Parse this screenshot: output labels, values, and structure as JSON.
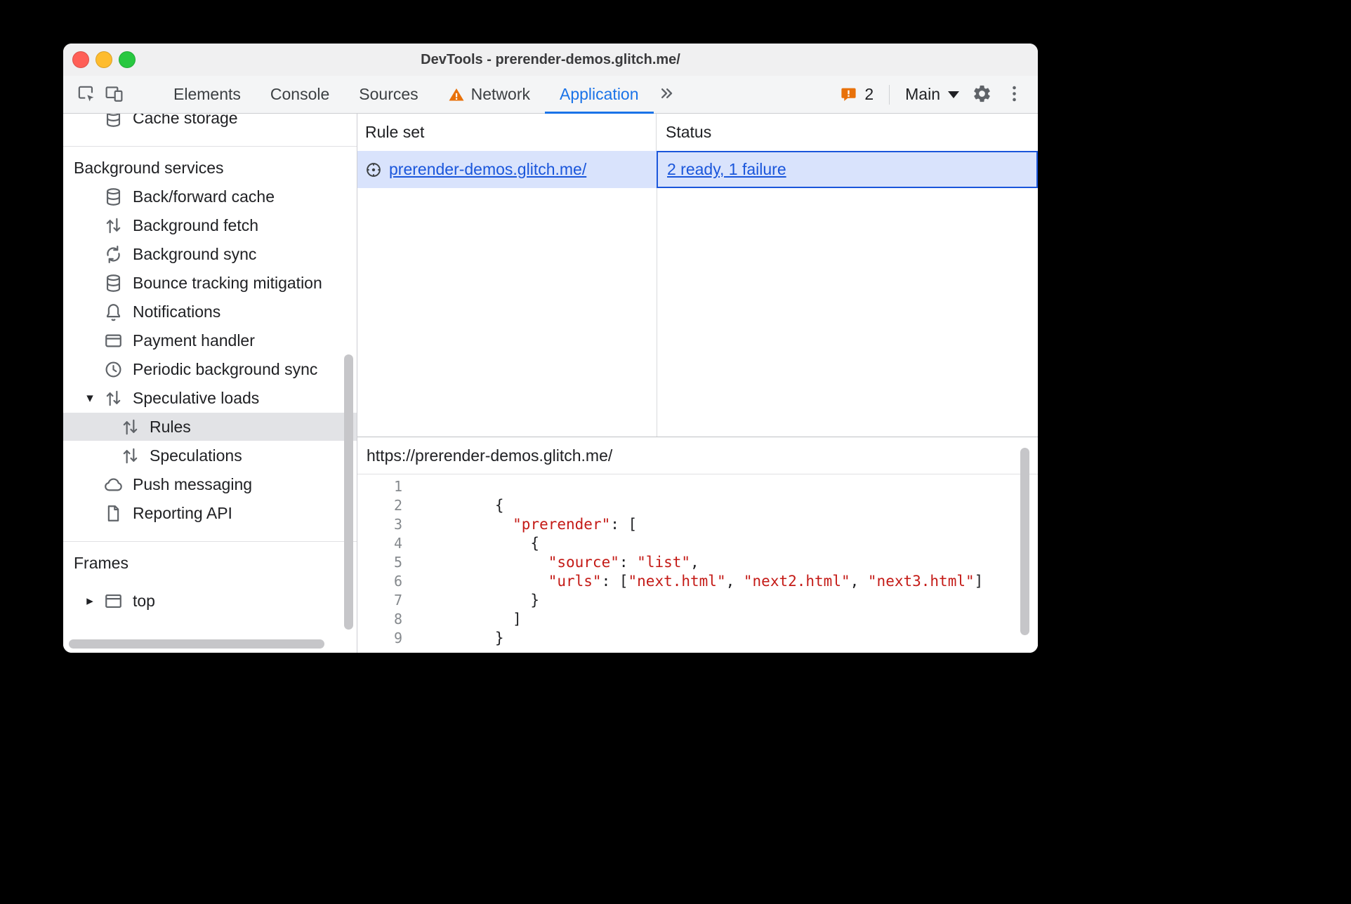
{
  "window": {
    "title": "DevTools - prerender-demos.glitch.me/"
  },
  "toolbar": {
    "tabs": [
      {
        "label": "Elements"
      },
      {
        "label": "Console"
      },
      {
        "label": "Sources"
      },
      {
        "label": "Network",
        "warning": true
      },
      {
        "label": "Application",
        "selected": true
      }
    ],
    "issues": {
      "count": "2"
    },
    "target_selector": {
      "label": "Main"
    }
  },
  "sidebar": {
    "clipped_item": {
      "label": "Cache storage",
      "icon": "database-icon"
    },
    "sections": [
      {
        "title": "Background services",
        "items": [
          {
            "label": "Back/forward cache",
            "icon": "database-icon"
          },
          {
            "label": "Background fetch",
            "icon": "up-down-arrows-icon"
          },
          {
            "label": "Background sync",
            "icon": "sync-arrows-icon"
          },
          {
            "label": "Bounce tracking mitigation",
            "icon": "database-icon"
          },
          {
            "label": "Notifications",
            "icon": "bell-icon"
          },
          {
            "label": "Payment handler",
            "icon": "payment-card-icon"
          },
          {
            "label": "Periodic background sync",
            "icon": "clock-icon"
          },
          {
            "label": "Speculative loads",
            "icon": "up-down-arrows-icon",
            "disclosure": "expanded"
          },
          {
            "label": "Rules",
            "icon": "up-down-arrows-icon",
            "indent": 1,
            "selected": true
          },
          {
            "label": "Speculations",
            "icon": "up-down-arrows-icon",
            "indent": 1
          },
          {
            "label": "Push messaging",
            "icon": "cloud-icon"
          },
          {
            "label": "Reporting API",
            "icon": "file-icon"
          }
        ]
      },
      {
        "title": "Frames",
        "items": [
          {
            "label": "top",
            "icon": "frame-icon",
            "disclosure": "collapsed"
          }
        ]
      }
    ]
  },
  "rule_sets": {
    "columns": [
      "Rule set",
      "Status"
    ],
    "rows": [
      {
        "rule_set": "prerender-demos.glitch.me/",
        "status": "2 ready, 1 failure",
        "icon": "rule-set-icon",
        "selected": true
      }
    ]
  },
  "details": {
    "url": "https://prerender-demos.glitch.me/",
    "code": {
      "lines": [
        {
          "n": "1",
          "tokens": []
        },
        {
          "n": "2",
          "tokens": [
            {
              "t": "      {",
              "c": "pun"
            }
          ]
        },
        {
          "n": "3",
          "tokens": [
            {
              "t": "        ",
              "c": "pun"
            },
            {
              "t": "\"prerender\"",
              "c": "str"
            },
            {
              "t": ": [",
              "c": "pun"
            }
          ]
        },
        {
          "n": "4",
          "tokens": [
            {
              "t": "          {",
              "c": "pun"
            }
          ]
        },
        {
          "n": "5",
          "tokens": [
            {
              "t": "            ",
              "c": "pun"
            },
            {
              "t": "\"source\"",
              "c": "str"
            },
            {
              "t": ": ",
              "c": "pun"
            },
            {
              "t": "\"list\"",
              "c": "str"
            },
            {
              "t": ",",
              "c": "pun"
            }
          ]
        },
        {
          "n": "6",
          "tokens": [
            {
              "t": "            ",
              "c": "pun"
            },
            {
              "t": "\"urls\"",
              "c": "str"
            },
            {
              "t": ": [",
              "c": "pun"
            },
            {
              "t": "\"next.html\"",
              "c": "str"
            },
            {
              "t": ", ",
              "c": "pun"
            },
            {
              "t": "\"next2.html\"",
              "c": "str"
            },
            {
              "t": ", ",
              "c": "pun"
            },
            {
              "t": "\"next3.html\"",
              "c": "str"
            },
            {
              "t": "]",
              "c": "pun"
            }
          ]
        },
        {
          "n": "7",
          "tokens": [
            {
              "t": "          }",
              "c": "pun"
            }
          ]
        },
        {
          "n": "8",
          "tokens": [
            {
              "t": "        ]",
              "c": "pun"
            }
          ]
        },
        {
          "n": "9",
          "tokens": [
            {
              "t": "      }",
              "c": "pun"
            }
          ]
        }
      ]
    }
  },
  "colors": {
    "accent": "#1a73e8",
    "link": "#1a56db",
    "warning": "#e8710a",
    "string": "#c41a16",
    "selected_row": "#d9e3fc",
    "sidebar_selection": "#e2e3e6"
  }
}
